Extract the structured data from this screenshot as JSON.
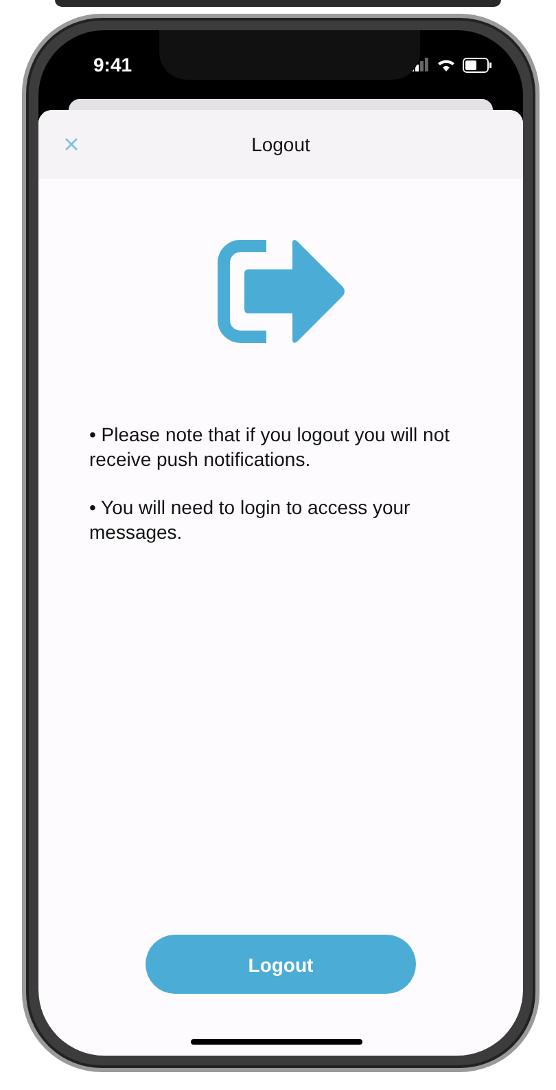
{
  "status_bar": {
    "time": "9:41"
  },
  "header": {
    "title": "Logout"
  },
  "notes": [
    "• Please note that if you logout you will not receive push notifications.",
    "• You will need to login to access your messages."
  ],
  "button": {
    "label": "Logout"
  }
}
